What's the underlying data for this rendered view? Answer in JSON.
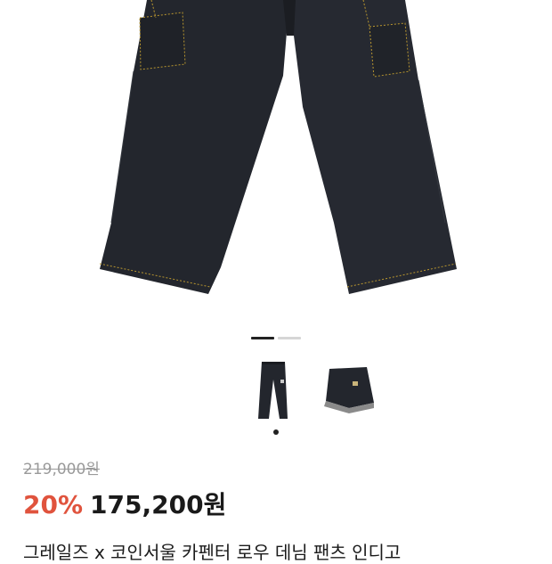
{
  "product": {
    "original_price": "219,000원",
    "discount": "20%",
    "sale_price": "175,200원",
    "title": "그레일즈 x 코인서울 카펜터 로우 데님 팬츠 인디고"
  },
  "gallery": {
    "page_count": 2,
    "current_page": 1,
    "thumbnails": [
      "pants-long-thumbnail",
      "shorts-thumbnail"
    ],
    "selected_thumbnail": 1
  },
  "colors": {
    "discount": "#e0533d",
    "denim": "#23262d",
    "stitch": "#b8962f"
  }
}
